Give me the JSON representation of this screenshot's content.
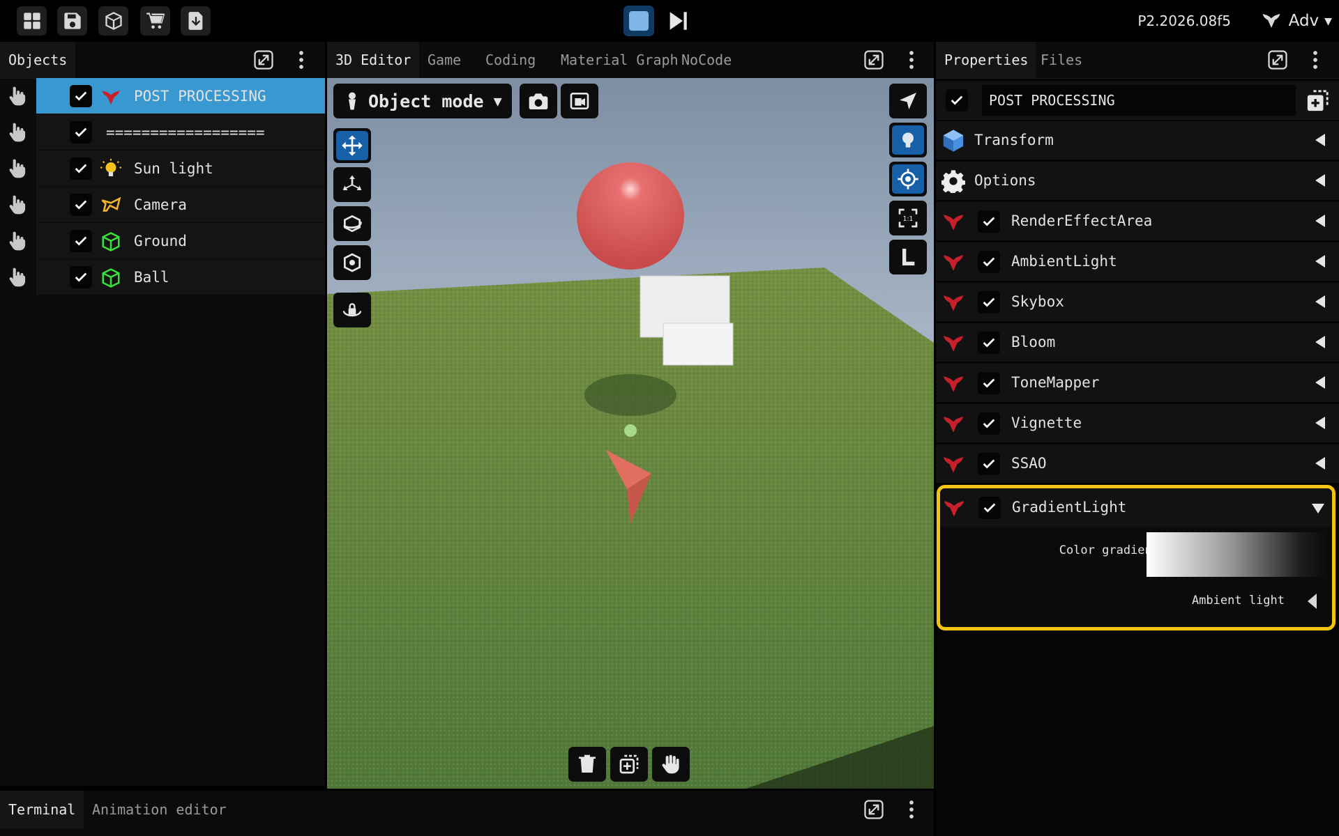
{
  "toolbar": {
    "version": "P2.2026.08f5",
    "user": "Adv"
  },
  "objects_panel": {
    "tab": "Objects",
    "items": [
      {
        "label": "POST PROCESSING",
        "selected": true
      },
      {
        "label": "=================="
      },
      {
        "label": "Sun light"
      },
      {
        "label": "Camera"
      },
      {
        "label": "Ground"
      },
      {
        "label": "Ball"
      }
    ]
  },
  "editor": {
    "tabs": [
      "3D Editor",
      "Game",
      "Coding",
      "Material Graph",
      "NoCode"
    ],
    "mode": "Object mode",
    "right_tools": [
      "select-arrow-icon",
      "light-bulb-icon",
      "target-icon",
      "one-to-one-icon",
      "local-L-icon"
    ],
    "left_tools": [
      "move-icon",
      "scale-icon",
      "rotate-icon",
      "transform-icon",
      "lock-rotate-icon"
    ],
    "bottom_tools": [
      "trash-icon",
      "duplicate-icon",
      "hand-icon"
    ]
  },
  "properties": {
    "tabs": [
      "Properties",
      "Files"
    ],
    "object_name": "POST PROCESSING",
    "sections": [
      {
        "label": "Transform",
        "icon": "cube-icon"
      },
      {
        "label": "Options",
        "icon": "gear-icon"
      }
    ],
    "effects": [
      {
        "label": "RenderEffectArea"
      },
      {
        "label": "AmbientLight"
      },
      {
        "label": "Skybox"
      },
      {
        "label": "Bloom"
      },
      {
        "label": "ToneMapper"
      },
      {
        "label": "Vignette"
      },
      {
        "label": "SSAO"
      }
    ],
    "expanded": {
      "label": "GradientLight",
      "color_gradient_label": "Color gradient",
      "ambient_light_label": "Ambient light"
    },
    "highlight_color": "#f2c40f"
  },
  "bottom": {
    "tabs": [
      "Terminal",
      "Animation editor"
    ]
  },
  "colors": {
    "selection": "#3a98d0",
    "accent_blue": "#1760a8",
    "effect_icon_red": "#c8202a",
    "ground_green": "#6a8c3c"
  }
}
